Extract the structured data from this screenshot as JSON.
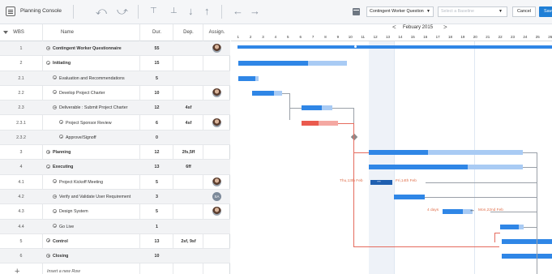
{
  "toolbar": {
    "title": "Planning Console",
    "scenario_select": "Contingent Worker Question",
    "baseline_placeholder": "Select a Baseline",
    "cancel_label": "Cancel",
    "save_label": "Save"
  },
  "grid": {
    "headers": {
      "wbs": "WBS",
      "name": "Name",
      "dur": "Dur.",
      "dep": "Dep.",
      "assign": "Assign."
    },
    "rows": [
      {
        "wbs": "1",
        "name": "Contingent Worker Questionnaire",
        "dur": "55",
        "dep": "",
        "toggle": "minus",
        "bold": true,
        "avatar": "photo"
      },
      {
        "wbs": "2",
        "name": "Initiating",
        "dur": "15",
        "dep": "",
        "toggle": "minus",
        "bold": true,
        "avatar": ""
      },
      {
        "wbs": "2.1",
        "name": "Evaluation and Recommendations",
        "dur": "5",
        "dep": "",
        "toggle": "minus",
        "bold": false,
        "avatar": ""
      },
      {
        "wbs": "2.2",
        "name": "Develop Project Charter",
        "dur": "10",
        "dep": "",
        "toggle": "minus",
        "bold": false,
        "avatar": "photo"
      },
      {
        "wbs": "2.3",
        "name": "Deliverable : Submit Project Charter",
        "dur": "12",
        "dep": "4sf",
        "toggle": "minus",
        "bold": false,
        "avatar": ""
      },
      {
        "wbs": "2.3.1",
        "name": "Project Sponsor Review",
        "dur": "6",
        "dep": "4sf",
        "toggle": "minus",
        "bold": false,
        "avatar": "photo"
      },
      {
        "wbs": "2.3.2",
        "name": "Approve/Signoff",
        "dur": "0",
        "dep": "",
        "toggle": "minus",
        "bold": false,
        "avatar": ""
      },
      {
        "wbs": "3",
        "name": "Planning",
        "dur": "12",
        "dep": "2fs,5ff",
        "toggle": "plus",
        "bold": true,
        "avatar": ""
      },
      {
        "wbs": "4",
        "name": "Executing",
        "dur": "13",
        "dep": "6ff",
        "toggle": "minus",
        "bold": true,
        "avatar": ""
      },
      {
        "wbs": "4.1",
        "name": "Project Kickoff Meeting",
        "dur": "5",
        "dep": "",
        "toggle": "minus",
        "bold": false,
        "avatar": "photo"
      },
      {
        "wbs": "4.2",
        "name": "Verify and Validate User Requirement",
        "dur": "3",
        "dep": "",
        "toggle": "minus",
        "bold": false,
        "avatar": "SA"
      },
      {
        "wbs": "4.3",
        "name": "Design System",
        "dur": "5",
        "dep": "",
        "toggle": "minus",
        "bold": false,
        "avatar": "photo"
      },
      {
        "wbs": "4.4",
        "name": "Go Live",
        "dur": "1",
        "dep": "",
        "toggle": "minus",
        "bold": false,
        "avatar": ""
      },
      {
        "wbs": "5",
        "name": "Control",
        "dur": "13",
        "dep": "2sf, 9sf",
        "toggle": "plus",
        "bold": true,
        "avatar": ""
      },
      {
        "wbs": "6",
        "name": "Closing",
        "dur": "10",
        "dep": "",
        "toggle": "plus",
        "bold": true,
        "avatar": ""
      }
    ],
    "insert_row": "Insert a new Row"
  },
  "gantt": {
    "month_label": "Febuary 2015",
    "days": [
      "1",
      "2",
      "3",
      "4",
      "5",
      "6",
      "7",
      "8",
      "9",
      "10",
      "11",
      "12",
      "13",
      "14",
      "15",
      "16",
      "17",
      "18",
      "19",
      "20",
      "21",
      "22",
      "23",
      "24",
      "25",
      "26"
    ],
    "labels": {
      "start_kickoff": "Thu,13th Feb",
      "end_kickoff": "Fri,14th Feb",
      "lag_design": "4 days",
      "end_design": "Mon,22nd Feb"
    }
  },
  "colors": {
    "bar_dark": "#2f86e6",
    "bar_light": "#a9cbf4",
    "critical_red": "#ea5a4e",
    "accent_button": "#1f7fd6"
  }
}
